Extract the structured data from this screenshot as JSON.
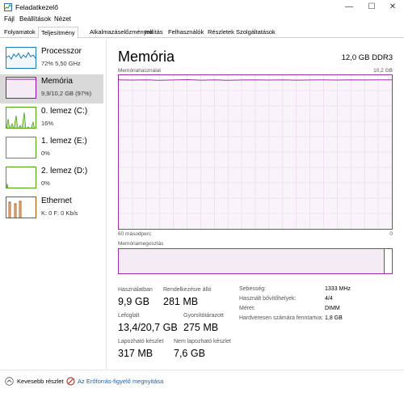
{
  "window": {
    "title": "Feladatkezelő",
    "minimize": "—",
    "maximize": "☐",
    "close": "✕"
  },
  "menu": [
    "Fájl",
    "Beállítások",
    "Nézet"
  ],
  "tabs": [
    "Folyamatok",
    "Teljesítmény",
    "Alkalmazáselőzmények",
    "Indítás",
    "Felhasználók",
    "Részletek",
    "Szolgáltatások"
  ],
  "active_tab": "Teljesítmény",
  "sidebar": {
    "items": [
      {
        "name": "Processzor",
        "sub": "72% 5,50 GHz",
        "color": "#117dbb"
      },
      {
        "name": "Memória",
        "sub": "9,9/10,2 GB (97%)",
        "color": "#8b12ae"
      },
      {
        "name": "0. lemez (C:)",
        "sub": "16%",
        "color": "#4da60c"
      },
      {
        "name": "1. lemez (E:)",
        "sub": "0%",
        "color": "#4da60c"
      },
      {
        "name": "2. lemez (D:)",
        "sub": "0%",
        "color": "#4da60c"
      },
      {
        "name": "Ethernet",
        "sub": "K: 0 F: 0 Kb/s",
        "color": "#a74f01"
      }
    ]
  },
  "main": {
    "title": "Memória",
    "spec": "12,0 GB DDR3",
    "graph_label": "Memóriahasználat",
    "graph_max": "10,2 GB",
    "graph_time_left": "60 másodperc",
    "graph_time_right": "0",
    "composition_label": "Memóriamegoszlás",
    "usage_fraction": 0.97,
    "stats": {
      "in_use_label": "Használatban",
      "in_use": "9,9 GB",
      "available_label": "Rendelkezésre álló",
      "available": "281 MB",
      "committed_label": "Lefoglalt",
      "committed": "13,4/20,7 GB",
      "cached_label": "Gyorsítótárazott",
      "cached": "275 MB",
      "paged_label": "Lapozható készlet",
      "paged": "317 MB",
      "nonpaged_label": "Nem lapozható készlet",
      "nonpaged": "7,6 GB"
    },
    "details": [
      {
        "label": "Sebesség:",
        "value": "1333 MHz"
      },
      {
        "label": "Használt bővítőhelyek:",
        "value": "4/4"
      },
      {
        "label": "Méret:",
        "value": "DIMM"
      },
      {
        "label": "Hardveresen számára fenntartva:",
        "value": "1,8 GB"
      }
    ]
  },
  "footer": {
    "fewer_details": "Kevesebb részlet",
    "open_monitor": "Az Erőforrás-figyelő megnyitása"
  },
  "accent": "#9d2ea8"
}
